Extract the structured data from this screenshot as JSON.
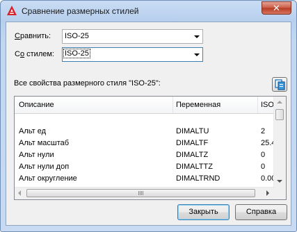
{
  "window": {
    "title": "Сравнение размерных стилей",
    "close_label": "✕"
  },
  "compare": {
    "label": "Сравнить:",
    "label_hotkey": "С",
    "label_rest": "равнить:",
    "value": "ISO-25"
  },
  "with": {
    "label": "Со стилем:",
    "label_hotkey": "о",
    "label_pre": "С",
    "label_rest": " стилем:",
    "value": "ISO-25"
  },
  "properties_label": "Все свойства размерного стиля \"ISO-25\":",
  "list": {
    "columns": [
      "Описание",
      "Переменная",
      "ISO-"
    ],
    "rows": [
      [
        "Альт ед",
        "DIMALTU",
        "2"
      ],
      [
        "Альт масштаб",
        "DIMALTF",
        "25.4"
      ],
      [
        "Альт нули",
        "DIMALTZ",
        "0"
      ],
      [
        "Альт нули доп",
        "DIMALTTZ",
        "0"
      ],
      [
        "Альт округление",
        "DIMALTRND",
        "0.00"
      ]
    ]
  },
  "buttons": {
    "close": "Закрыть",
    "help": "Справка"
  },
  "colors": {
    "accent": "#3c7fb1",
    "app_icon": "#d4232b"
  }
}
